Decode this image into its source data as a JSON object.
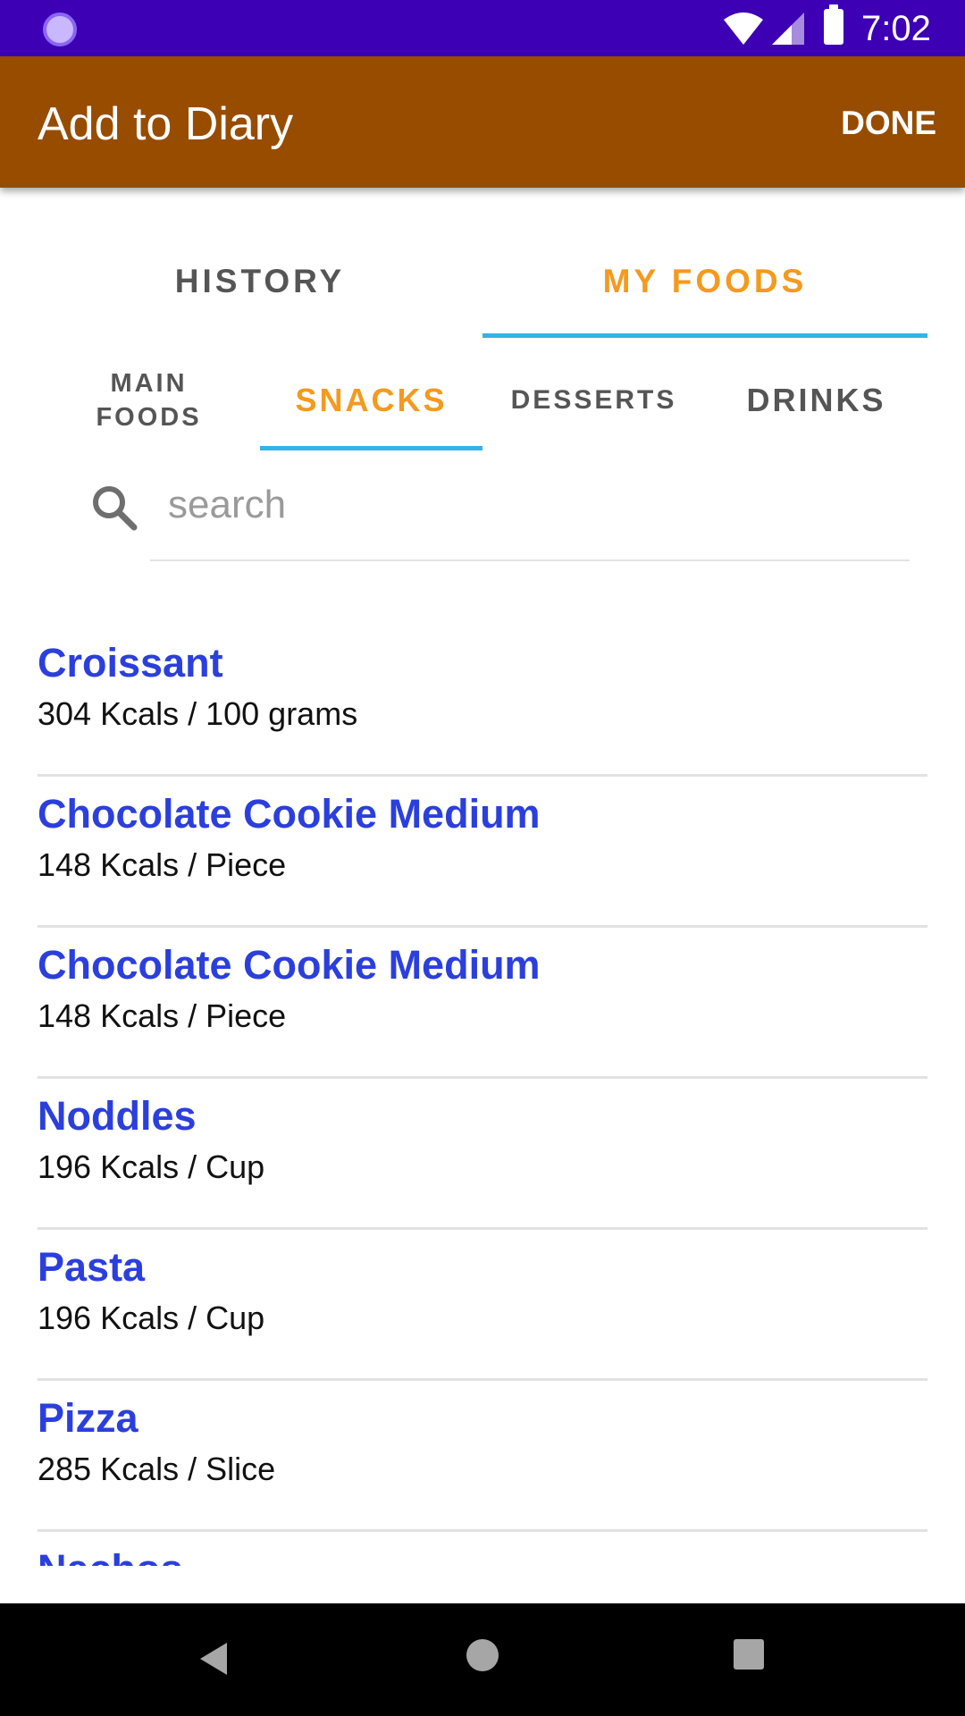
{
  "status_bar": {
    "time": "7:02",
    "icons": [
      "app-notification-icon",
      "wifi-icon",
      "signal-icon",
      "battery-icon"
    ]
  },
  "app_bar": {
    "title": "Add to Diary",
    "done_label": "DONE",
    "background": "#974c00"
  },
  "top_tabs": {
    "items": [
      {
        "label": "HISTORY",
        "active": false
      },
      {
        "label": "MY FOODS",
        "active": true
      }
    ]
  },
  "sub_tabs": {
    "items": [
      {
        "label": "MAIN FOODS",
        "active": false
      },
      {
        "label": "SNACKS",
        "active": true
      },
      {
        "label": "DESSERTS",
        "active": false
      },
      {
        "label": "DRINKS",
        "active": false
      }
    ]
  },
  "search": {
    "placeholder": "search",
    "value": ""
  },
  "foods": [
    {
      "name": "Croissant",
      "kcal": "304 Kcals / 100 grams"
    },
    {
      "name": "Chocolate Cookie Medium",
      "kcal": "148 Kcals / Piece"
    },
    {
      "name": "Chocolate Cookie Medium",
      "kcal": "148 Kcals / Piece"
    },
    {
      "name": "Noddles",
      "kcal": "196 Kcals / Cup"
    },
    {
      "name": "Pasta",
      "kcal": "196 Kcals / Cup"
    },
    {
      "name": "Pizza",
      "kcal": "285 Kcals / Slice"
    },
    {
      "name": "Nachos",
      "kcal": ""
    }
  ],
  "colors": {
    "status_bar": "#3d00b5",
    "accent": "#f49a1e",
    "indicator": "#33b3e6",
    "food_name": "#2b3fdd"
  },
  "nav_bar": {
    "icons": [
      "back-icon",
      "home-icon",
      "recents-icon"
    ]
  }
}
